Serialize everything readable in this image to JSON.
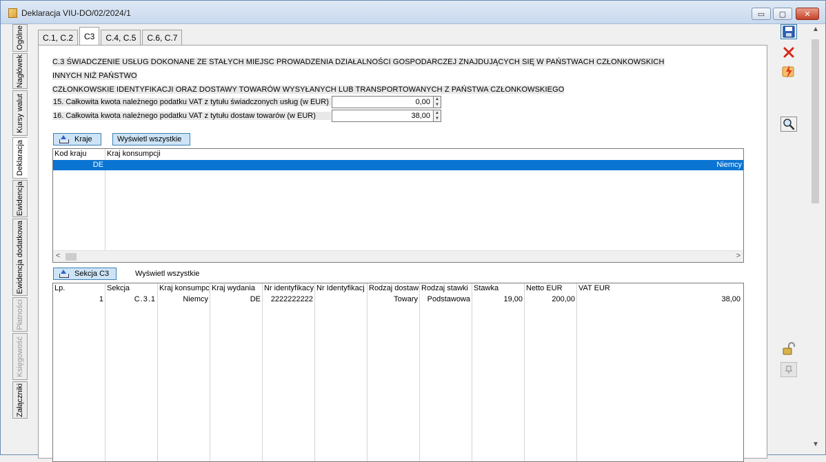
{
  "window": {
    "title": "Deklaracja VIU-DO/02/2024/1",
    "min_glyph": "▭",
    "max_glyph": "▢",
    "close_glyph": "✕"
  },
  "vertical_tabs": [
    {
      "label": "Ogólne",
      "state": "normal"
    },
    {
      "label": "Nagłówek",
      "state": "normal"
    },
    {
      "label": "Kursy walut",
      "state": "normal"
    },
    {
      "label": "Deklaracja",
      "state": "active"
    },
    {
      "label": "Ewidencja",
      "state": "normal"
    },
    {
      "label": "Ewidencja dodatkowa",
      "state": "normal"
    },
    {
      "label": "Płatności",
      "state": "disabled"
    },
    {
      "label": "Księgowość",
      "state": "disabled"
    },
    {
      "label": "Załączniki",
      "state": "normal"
    }
  ],
  "tabs": [
    {
      "label": "C.1, C.2",
      "active": false
    },
    {
      "label": "C3",
      "active": true
    },
    {
      "label": "C.4, C.5",
      "active": false
    },
    {
      "label": "C.6, C.7",
      "active": false
    }
  ],
  "section": {
    "heading_line1": "C.3 ŚWIADCZENIE USŁUG DOKONANE ZE STAŁYCH MIEJSC PROWADZENIA DZIAŁALNOŚCI GOSPODARCZEJ ZNAJDUJĄCYCH SIĘ W PAŃSTWACH CZŁONKOWSKICH INNYCH NIŻ PAŃSTWO",
    "heading_line2": "CZŁONKOWSKIE IDENTYFIKACJI ORAZ DOSTAWY TOWARÓW WYSYŁANYCH LUB TRANSPORTOWANYCH Z PAŃSTWA CZŁONKOWSKIEGO"
  },
  "fields": {
    "f15_label": "15. Całkowita kwota należnego podatku VAT z tytułu świadczonych usług (w EUR)",
    "f15_value": "0,00",
    "f16_label": "16. Całkowita kwota należnego podatku VAT z tytułu dostaw towarów (w EUR)",
    "f16_value": "38,00"
  },
  "buttons": {
    "kraje": "Kraje",
    "show_all_1": "Wyświetl wszystkie",
    "sekcja_c3": "Sekcja C3",
    "show_all_2": "Wyświetl wszystkie"
  },
  "countries_grid": {
    "headers": [
      "Kod kraju",
      "Kraj konsumpcji"
    ],
    "rows": [
      {
        "code": "DE",
        "country": "Niemcy"
      }
    ]
  },
  "c3_grid": {
    "headers": [
      "Lp.",
      "Sekcja",
      "Kraj konsumpcj",
      "Kraj wydania",
      "Nr identyfikacy",
      "Nr Identyfikacj",
      "Rodzaj dostaw",
      "Rodzaj stawki",
      "Stawka",
      "Netto EUR",
      "VAT EUR"
    ],
    "rows": [
      [
        "1",
        "C.3.1",
        "Niemcy",
        "DE",
        "2222222222",
        "",
        "Towary",
        "Podstawowa",
        "19,00",
        "200,00",
        "38,00"
      ]
    ]
  },
  "toolbar_icons": [
    "save-icon",
    "delete-icon",
    "lightning-icon",
    "magnifier-icon",
    "unlock-icon",
    "pin-icon"
  ],
  "colors": {
    "selection": "#0a74d3",
    "button_bg": "#cde4f7",
    "button_border": "#3c7fb1"
  }
}
